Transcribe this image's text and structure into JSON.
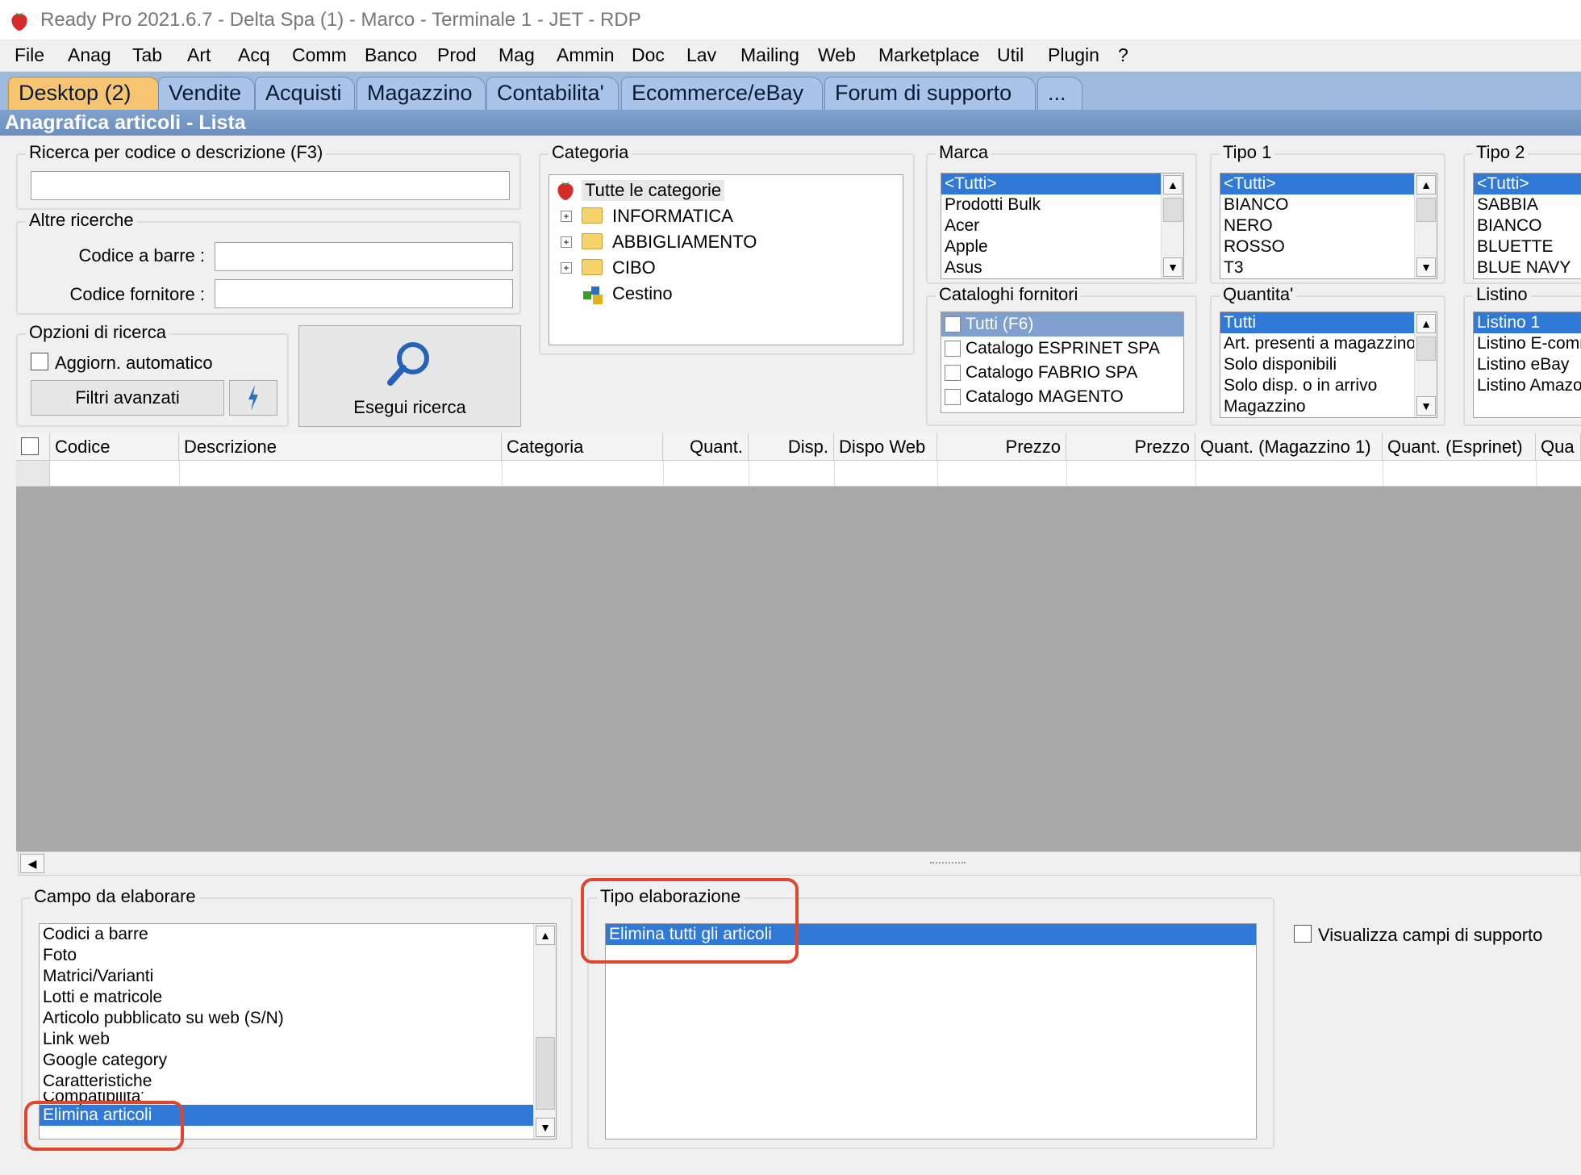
{
  "window": {
    "title": "Ready Pro 2021.6.7 - Delta Spa (1) - Marco - Terminale 1 - JET - RDP"
  },
  "menu": [
    "File",
    "Anag",
    "Tab",
    "Art",
    "Acq",
    "Comm",
    "Banco",
    "Prod",
    "Mag",
    "Ammin",
    "Doc",
    "Lav",
    "Mailing",
    "Web",
    "Marketplace",
    "Util",
    "Plugin",
    "?"
  ],
  "tabs": [
    "Desktop (2)",
    "Vendite",
    "Acquisti",
    "Magazzino",
    "Contabilita'",
    "Ecommerce/eBay",
    "Forum di supporto",
    "..."
  ],
  "section_title": "Anagrafica articoli  - Lista",
  "search": {
    "group_label": "Ricerca per codice o descrizione (F3)",
    "value": "",
    "other_label": "Altre ricerche",
    "barcode_label": "Codice a barre :",
    "supplier_code_label": "Codice fornitore :"
  },
  "options": {
    "group_label": "Opzioni di ricerca",
    "auto_update_label": "Aggiorn. automatico",
    "advanced_filters_label": "Filtri avanzati",
    "run_search_label": "Esegui ricerca"
  },
  "category": {
    "group_label": "Categoria",
    "root": "Tutte le categorie",
    "nodes": [
      "INFORMATICA",
      "ABBIGLIAMENTO",
      "CIBO",
      "Cestino"
    ]
  },
  "marca": {
    "group_label": "Marca",
    "items": [
      "<Tutti>",
      "Prodotti Bulk",
      "Acer",
      "Apple",
      "Asus"
    ]
  },
  "tipo1": {
    "group_label": "Tipo 1",
    "items": [
      "<Tutti>",
      "BIANCO",
      "NERO",
      "ROSSO",
      "T3"
    ]
  },
  "tipo2": {
    "group_label": "Tipo 2",
    "items": [
      "<Tutti>",
      "SABBIA",
      "BIANCO",
      "BLUETTE",
      "BLUE NAVY"
    ]
  },
  "cataloghi": {
    "group_label": "Cataloghi fornitori",
    "items": [
      "Tutti (F6)",
      "Catalogo ESPRINET SPA",
      "Catalogo FABRIO SPA",
      "Catalogo MAGENTO"
    ]
  },
  "quantita": {
    "group_label": "Quantita'",
    "items": [
      "Tutti",
      "Art. presenti a magazzino",
      "Solo disponibili",
      "Solo disp. o in arrivo",
      "Magazzino"
    ]
  },
  "listino": {
    "group_label": "Listino",
    "items": [
      "Listino 1",
      "Listino E-commerce",
      "Listino eBay",
      "Listino Amazon"
    ]
  },
  "grid": {
    "columns": [
      "Codice",
      "Descrizione",
      "Categoria",
      "Quant.",
      "Disp.",
      "Dispo Web",
      "Prezzo",
      "Prezzo",
      "Quant. (Magazzino 1)",
      "Quant. (Esprinet)",
      "Qua"
    ]
  },
  "campo": {
    "group_label": "Campo da elaborare",
    "items": [
      "Codici a barre",
      "Foto",
      "Matrici/Varianti",
      "Lotti e matricole",
      "Articolo pubblicato su web (S/N)",
      "Link web",
      "Google category",
      "Caratteristiche",
      "Compatibilita'",
      "Elimina articoli"
    ]
  },
  "tipo_elab": {
    "group_label": "Tipo elaborazione",
    "items": [
      "Elimina tutti gli articoli"
    ]
  },
  "support_fields_label": "Visualizza campi di supporto",
  "colors": {
    "selection": "#3179d7",
    "tab_active": "#f7c572",
    "tabbar": "#9cb9de",
    "highlight": "#e0462e"
  }
}
